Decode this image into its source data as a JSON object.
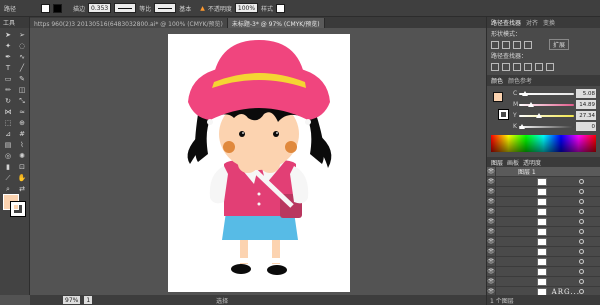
{
  "control_bar": {
    "label_unselected": "路径",
    "stroke_label": "描边",
    "stroke_value": "0.353",
    "profile_label": "等比",
    "brush_label": "基本",
    "opacity_label": "不透明度",
    "opacity_value": "100%",
    "style_label": "样式",
    "warning": "▲",
    "fill_color": "#ffffff",
    "stroke_color": "#000000"
  },
  "tabs": [
    {
      "label": "https 960(2)3 20130516(6483032800.ai* @ 100% (CMYK/预览)",
      "active": false
    },
    {
      "label": "未标题-3* @ 97% (CMYK/预览)",
      "active": true
    }
  ],
  "tools_panel": {
    "title": "工具",
    "icons": [
      "selection-icon",
      "direct-selection-icon",
      "magic-wand-icon",
      "lasso-icon",
      "pen-icon",
      "curvature-icon",
      "type-icon",
      "line-icon",
      "rectangle-icon",
      "paintbrush-icon",
      "pencil-icon",
      "eraser-icon",
      "rotate-icon",
      "scale-icon",
      "width-icon",
      "warp-icon",
      "free-transform-icon",
      "shape-builder-icon",
      "perspective-icon",
      "mesh-icon",
      "gradient-icon",
      "eyedropper-icon",
      "blend-icon",
      "symbol-sprayer-icon",
      "graph-icon",
      "artboard-icon",
      "slice-icon",
      "hand-icon",
      "zoom-icon",
      "swap-icon"
    ],
    "fill_color": "#fcd3b0",
    "stroke_color": "#ffffff"
  },
  "status_bar": {
    "zoom": "97%",
    "page": "1",
    "mode": "选择"
  },
  "right_panel": {
    "pathfinder_tabs": [
      "路径查找器",
      "对齐",
      "变换"
    ],
    "shape_modes_label": "形状模式：",
    "expand_label": "扩展",
    "pathfinders_label": "路径查找器：",
    "color_tabs": [
      "颜色",
      "颜色参考"
    ],
    "color_channels": [
      {
        "name": "C",
        "value": "5.08",
        "track": "#e6e6e6",
        "pos": 0.05
      },
      {
        "name": "M",
        "value": "14.89",
        "track": "#e05a8a",
        "pos": 0.15
      },
      {
        "name": "Y",
        "value": "27.34",
        "track": "#f2e64a",
        "pos": 0.27
      },
      {
        "name": "K",
        "value": "0",
        "track": "#444444",
        "pos": 0.0
      }
    ],
    "color_swatch": "#fcd3b0",
    "layers_tabs": [
      "图层",
      "画板",
      "透明度"
    ],
    "layer_name": "图层 1",
    "layer_count_label": "1 个图层",
    "layer_rows": 14
  },
  "watermark": {
    "text": "ARG...",
    "logo_letter": "S",
    "logo_text": "英"
  },
  "artwork": {
    "hat_color": "#f0457e",
    "hat_band": "#f5d533",
    "hair": "#0b0b0b",
    "skin": "#fcd3b0",
    "cheek": "#e0893d",
    "dress": "#e23f75",
    "skirt": "#57bbe6",
    "collar": "#f6f6f6",
    "shoes": "#0b0b0b"
  }
}
